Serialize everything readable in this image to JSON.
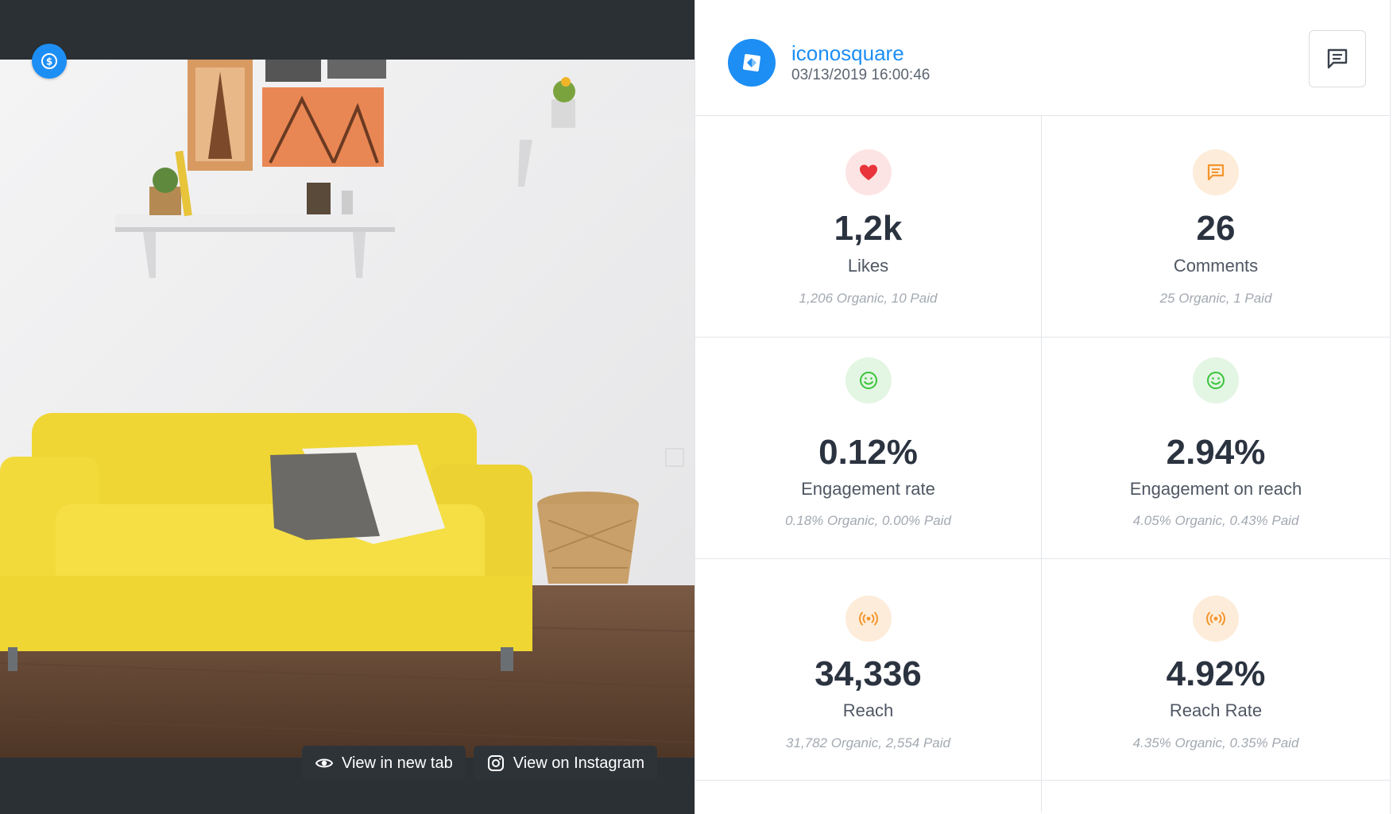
{
  "post": {
    "account_name": "iconosquare",
    "date": "03/13/2019 16:00:46",
    "paid_badge_icon": "dollar-coin-icon",
    "avatar_icon": "iconosquare-logo-icon"
  },
  "media_actions": {
    "view_new_tab": "View in new tab",
    "view_instagram": "View on Instagram"
  },
  "metrics": [
    {
      "icon": "heart-icon",
      "color": "#e8343a",
      "value": "1,2k",
      "label": "Likes",
      "sub": "1,206 Organic, 10 Paid"
    },
    {
      "icon": "comment-icon",
      "color": "#f3952d",
      "value": "26",
      "label": "Comments",
      "sub": "25 Organic, 1 Paid"
    },
    {
      "icon": "smiley-icon",
      "color": "#3ac43a",
      "value": "0.12%",
      "label": "Engagement rate",
      "sub": "0.18% Organic, 0.00% Paid"
    },
    {
      "icon": "smiley-icon",
      "color": "#3ac43a",
      "value": "2.94%",
      "label": "Engagement on reach",
      "sub": "4.05% Organic, 0.43% Paid"
    },
    {
      "icon": "broadcast-icon",
      "color": "#f3952d",
      "value": "34,336",
      "label": "Reach",
      "sub": "31,782 Organic, 2,554 Paid"
    },
    {
      "icon": "broadcast-icon",
      "color": "#f3952d",
      "value": "4.92%",
      "label": "Reach Rate",
      "sub": "4.35% Organic, 0.35% Paid"
    }
  ],
  "colors": {
    "accent": "#1d8ef4",
    "media_background": "#2b3035",
    "sofa": "#f3dc3a"
  }
}
